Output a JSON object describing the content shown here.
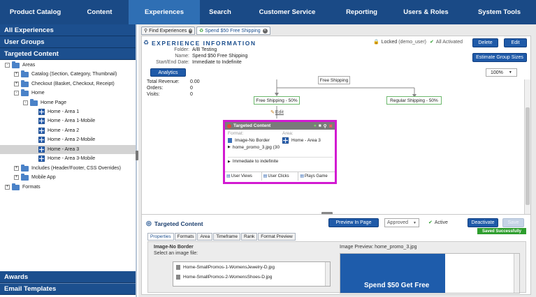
{
  "nav": {
    "items": [
      {
        "label": "Product Catalog",
        "active": false
      },
      {
        "label": "Content",
        "active": false
      },
      {
        "label": "Experiences",
        "active": true
      },
      {
        "label": "Search",
        "active": false
      },
      {
        "label": "Customer Service",
        "active": false
      },
      {
        "label": "Reporting",
        "active": false
      },
      {
        "label": "Users & Roles",
        "active": false
      },
      {
        "label": "System Tools",
        "active": false
      }
    ]
  },
  "sidebar": {
    "all_experiences": "All Experiences",
    "user_groups": "User Groups",
    "targeted_content": "Targeted Content",
    "awards": "Awards",
    "email_templates": "Email Templates",
    "tree": [
      {
        "label": "Areas",
        "toggle": "-",
        "icon": "folder-icon"
      },
      {
        "label": "Catalog (Section, Category, Thumbnail)",
        "toggle": "+",
        "icon": "folder-icon"
      },
      {
        "label": "Checkout (Basket, Checkout, Receipt)",
        "toggle": "+",
        "icon": "folder-icon"
      },
      {
        "label": "Home",
        "toggle": "-",
        "icon": "folder-icon"
      },
      {
        "label": "Home Page",
        "toggle": "-",
        "icon": "folder-icon"
      },
      {
        "label": "Home - Area 1",
        "toggle": "",
        "icon": "grid-icon"
      },
      {
        "label": "Home - Area 1-Mobile",
        "toggle": "",
        "icon": "grid-icon"
      },
      {
        "label": "Home - Area 2",
        "toggle": "",
        "icon": "grid-icon"
      },
      {
        "label": "Home - Area 2-Mobile",
        "toggle": "",
        "icon": "grid-icon"
      },
      {
        "label": "Home - Area 3",
        "toggle": "",
        "icon": "grid-icon",
        "selected": true
      },
      {
        "label": "Home - Area 3-Mobile",
        "toggle": "",
        "icon": "grid-icon"
      },
      {
        "label": "Includes (Header/Footer, CSS Overrides)",
        "toggle": "+",
        "icon": "folder-icon"
      },
      {
        "label": "Mobile App",
        "toggle": "+",
        "icon": "folder-icon"
      },
      {
        "label": "Formats",
        "toggle": "+",
        "icon": "folder-icon"
      }
    ]
  },
  "tabs": [
    {
      "label": "Find Experiences"
    },
    {
      "label": "Spend $50 Free Shipping"
    }
  ],
  "experience": {
    "title": "EXPERIENCE INFORMATION",
    "folder_label": "Folder:",
    "folder_value": "A/B Testing",
    "name_label": "Name:",
    "name_value": "Spend $50 Free Shipping",
    "dates_label": "Start/End Date:",
    "dates_value": "Immediate to Indefinite",
    "locked_text": "Locked",
    "locked_user": "(demo_user)",
    "activated_text": "All Activated",
    "delete_button": "Delete",
    "edit_button": "Edit",
    "estimate_button": "Estimate Group Sizes",
    "analytics_button": "Analytics",
    "total_revenue_label": "Total Revenue:",
    "total_revenue_value": "0.00",
    "orders_label": "Orders:",
    "orders_value": "0",
    "visits_label": "Visits:",
    "visits_value": "0",
    "zoom": "100%"
  },
  "graph": {
    "root_node": "Free Shipping",
    "left_node": "Free Shipping - 50%",
    "right_node": "Regular Shipping - 50%",
    "edit_link": "Edit",
    "tc_title": "Targeted Content",
    "tc_format_label": "Format:",
    "tc_format_value": "Image-No Border",
    "tc_file": "home_promo_3.jpg (30",
    "tc_area_label": "Area:",
    "tc_area_value": "Home - Area 3",
    "tc_dates": "Immediate to indefinite",
    "tc_user_views": "User Views",
    "tc_user_clicks": "User Clicks",
    "tc_plays_game": "Plays Game"
  },
  "bottom": {
    "title": "Targeted Content",
    "preview_button": "Preview In Page",
    "status_select": "Approved",
    "active_label": "Active",
    "deactivate_button": "Deactivate",
    "save_button": "Save",
    "saved_badge": "Saved Successfully",
    "tabs": [
      "Properties",
      "Formats",
      "Area",
      "Timeframe",
      "Rank",
      "Format Preview"
    ],
    "format_name": "Image-No Border",
    "select_image_label": "Select an image file:",
    "files": [
      "Home-SmallPromos-1-WomensJewelry-D.jpg",
      "Home-SmallPromos-2-WomensShoes-D.jpg"
    ],
    "image_preview_label": "Image Preview: home_promo_3.jpg",
    "preview_text": "Spend $50 Get Free"
  },
  "colors": {
    "nav_bg": "#1a4a86",
    "nav_active": "#2f6fb4",
    "highlight": "#d21ad1",
    "node_border": "#6cb86c",
    "saved_green": "#2e9e2e"
  }
}
